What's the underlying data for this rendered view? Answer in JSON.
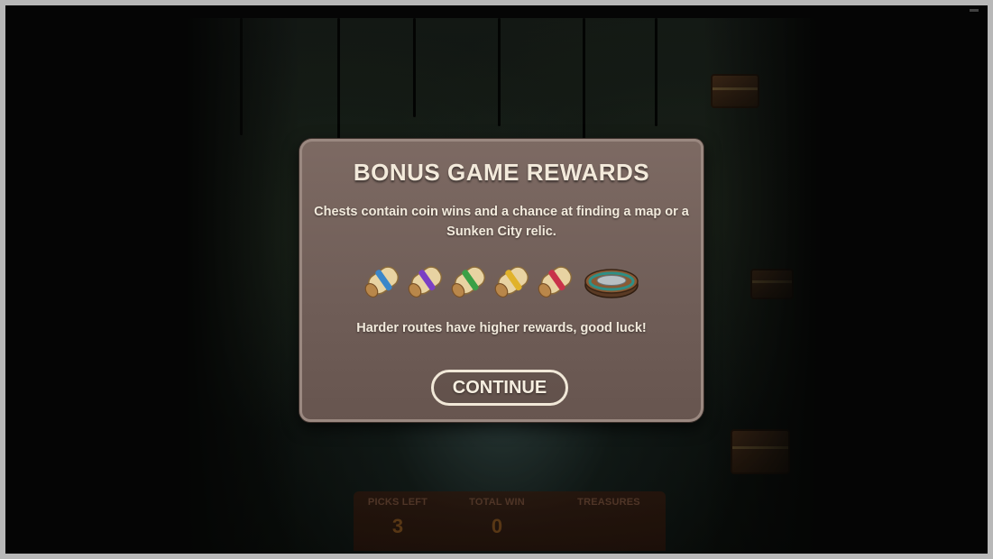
{
  "popup": {
    "title": "BONUS GAME REWARDS",
    "description": "Chests contain coin wins and a chance at finding a map or a Sunken City relic.",
    "hint": "Harder routes have higher rewards, good luck!",
    "continue_label": "CONTINUE",
    "rewards": [
      {
        "icon": "map-scroll-icon",
        "ribbon_color": "#3a86c9"
      },
      {
        "icon": "map-scroll-icon",
        "ribbon_color": "#7a3fc4"
      },
      {
        "icon": "map-scroll-icon",
        "ribbon_color": "#3aa046"
      },
      {
        "icon": "map-scroll-icon",
        "ribbon_color": "#e0b22a"
      },
      {
        "icon": "map-scroll-icon",
        "ribbon_color": "#c8324a"
      },
      {
        "icon": "sunken-city-relic-icon",
        "ribbon_color": "#2e8f86"
      }
    ]
  },
  "hud": {
    "picks_left_label": "PICKS LEFT",
    "picks_left_value": "3",
    "total_win_label": "TOTAL WIN",
    "total_win_value": "0",
    "treasures_label": "TREASURES"
  }
}
